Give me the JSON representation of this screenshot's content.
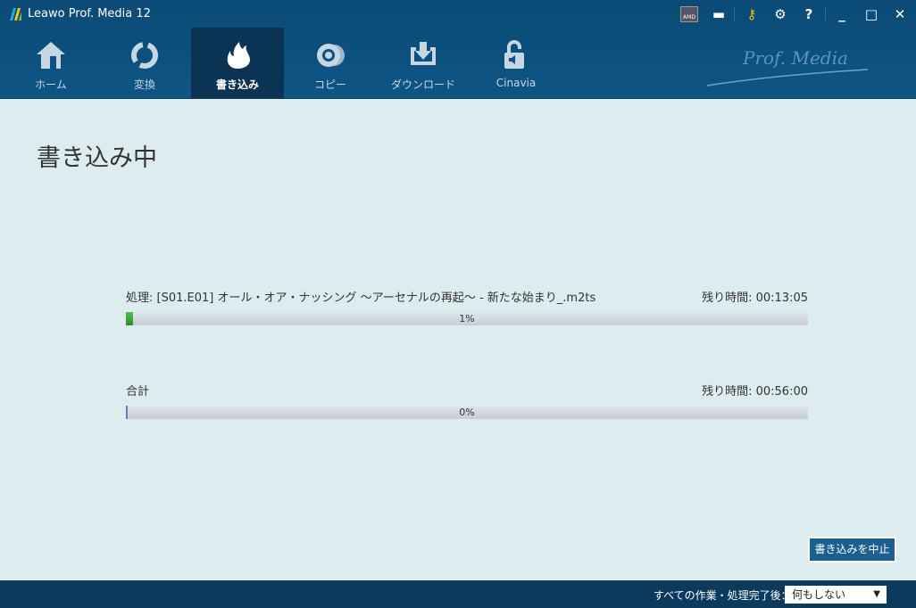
{
  "window": {
    "title": "Leawo Prof. Media 12",
    "brand": "Prof. Media"
  },
  "nav": {
    "tabs": [
      {
        "label": "ホーム"
      },
      {
        "label": "変換"
      },
      {
        "label": "書き込み"
      },
      {
        "label": "コピー"
      },
      {
        "label": "ダウンロード"
      },
      {
        "label": "Cinavia"
      }
    ],
    "active": 2
  },
  "main": {
    "title": "書き込み中",
    "current": {
      "label": "処理: [S01.E01] オール・オア・ナッシング ～アーセナルの再起～ - 新たな始まり_.m2ts",
      "remaining": "残り時間: 00:13:05",
      "percent_label": "1%",
      "progress": 1
    },
    "total": {
      "label": "合計",
      "remaining": "残り時間: 00:56:00",
      "percent_label": "0%",
      "progress": 0
    },
    "stop_button": "書き込みを中止"
  },
  "footer": {
    "after_label": "すべての作業・処理完了後：",
    "after_value": "何もしない"
  },
  "colors": {
    "accent": "#1e5f91",
    "progress": "#3caa3c"
  }
}
